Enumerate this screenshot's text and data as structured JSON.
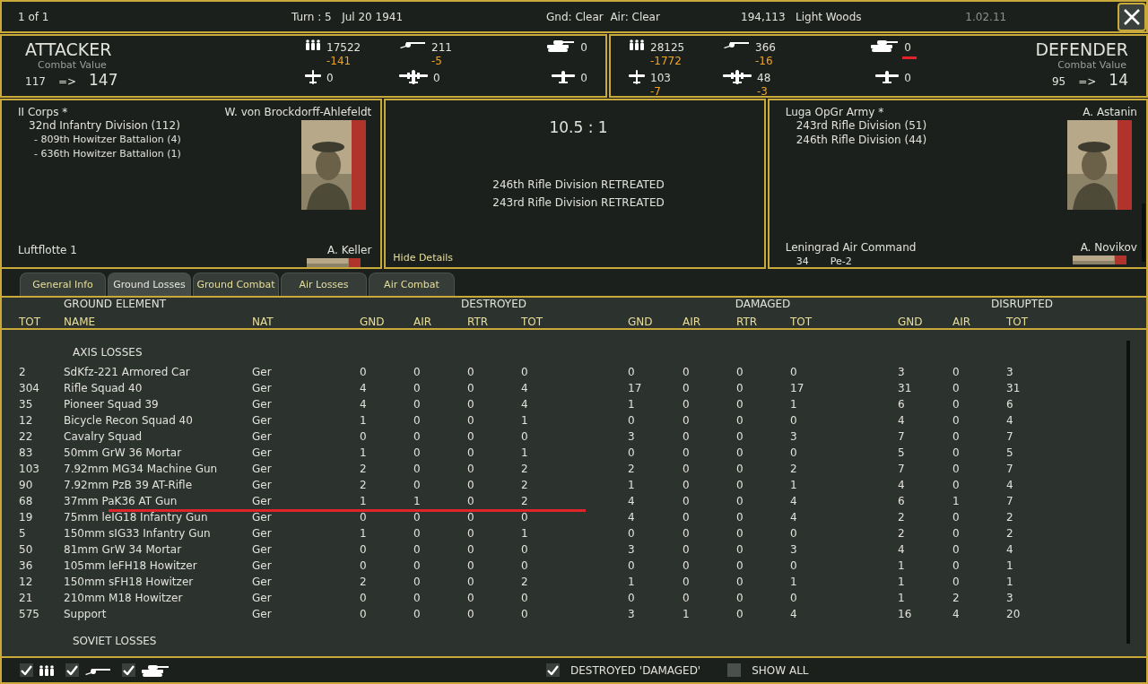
{
  "top_bar": {
    "page": "1 of 1",
    "turn": "Turn : 5   Jul 20 1941",
    "weather": "Gnd: Clear  Air: Clear",
    "location": "194,113   Light Woods",
    "version": "1.02.11"
  },
  "attacker": {
    "title": "ATTACKER",
    "cv_label": "Combat Value",
    "cv_from": "117",
    "cv_arrow": "=>",
    "cv_to": "147",
    "stats": [
      {
        "kind": "men",
        "value": "17522",
        "loss": "-141",
        "underlined": false
      },
      {
        "kind": "gun",
        "value": "211",
        "loss": "-5",
        "underlined": false
      },
      {
        "kind": "tank",
        "value": "0",
        "underlined": false
      },
      {
        "kind": "fighter",
        "value": "0",
        "underlined": false
      },
      {
        "kind": "bomber",
        "value": "0",
        "underlined": false
      },
      {
        "kind": "plane",
        "value": "0",
        "underlined": false
      }
    ]
  },
  "defender": {
    "title": "DEFENDER",
    "cv_label": "Combat Value",
    "cv_from": "95",
    "cv_arrow": "=>",
    "cv_to": "14",
    "stats": [
      {
        "kind": "men",
        "value": "28125",
        "loss": "-1772",
        "underlined": false
      },
      {
        "kind": "gun",
        "value": "366",
        "loss": "-16",
        "underlined": false
      },
      {
        "kind": "tank",
        "value": "0",
        "underlined": true
      },
      {
        "kind": "fighter",
        "value": "103",
        "loss": "-7",
        "underlined": false
      },
      {
        "kind": "bomber",
        "value": "48",
        "loss": "-3",
        "underlined": false
      },
      {
        "kind": "plane",
        "value": "0",
        "underlined": false
      }
    ]
  },
  "attacker_panel": {
    "hq": "II Corps *",
    "commander": "W. von Brockdorff-Ahlefeldt",
    "units": [
      {
        "name": "32nd Infantry Division (112)",
        "children": [
          {
            "name": "- 809th Howitzer Battalion (4)"
          },
          {
            "name": "- 636th Howitzer Battalion (1)"
          }
        ]
      }
    ],
    "air_hq": "Luftflotte 1",
    "air_commander": "A. Keller"
  },
  "result_panel": {
    "odds": "10.5 : 1",
    "results": [
      "246th Rifle Division RETREATED",
      "243rd Rifle Division RETREATED"
    ],
    "hide_link": "Hide Details"
  },
  "defender_panel": {
    "hq": "Luga OpGr Army *",
    "commander": "A. Astanin",
    "units": [
      {
        "name": "243rd Rifle Division (51)"
      },
      {
        "name": "246th Rifle Division (44)"
      }
    ],
    "air_hq": "Leningrad Air Command",
    "air_commander": "A. Novikov",
    "air_units": [
      {
        "count": "34",
        "type": "Pe-2"
      }
    ]
  },
  "tabs": [
    {
      "label": "General Info",
      "selected": false
    },
    {
      "label": "Ground Losses",
      "selected": true
    },
    {
      "label": "Ground Combat",
      "selected": false
    },
    {
      "label": "Air Losses",
      "selected": false
    },
    {
      "label": "Air Combat",
      "selected": false
    }
  ],
  "table": {
    "groups": [
      "GROUND ELEMENT",
      "DESTROYED",
      "DAMAGED",
      "DISRUPTED"
    ],
    "columns": [
      "TOT",
      "NAME",
      "NAT",
      "GND",
      "AIR",
      "RTR",
      "TOT",
      "GND",
      "AIR",
      "RTR",
      "TOT",
      "GND",
      "AIR",
      "TOT"
    ],
    "sections": [
      {
        "title": "AXIS LOSSES",
        "rows": [
          {
            "cells": [
              "2",
              "SdKfz-221 Armored Car",
              "Ger",
              "0",
              "0",
              "0",
              "0",
              "0",
              "0",
              "0",
              "0",
              "3",
              "0",
              "3"
            ],
            "underlined": false
          },
          {
            "cells": [
              "304",
              "Rifle Squad 40",
              "Ger",
              "4",
              "0",
              "0",
              "4",
              "17",
              "0",
              "0",
              "17",
              "31",
              "0",
              "31"
            ],
            "underlined": false
          },
          {
            "cells": [
              "35",
              "Pioneer Squad 39",
              "Ger",
              "4",
              "0",
              "0",
              "4",
              "1",
              "0",
              "0",
              "1",
              "6",
              "0",
              "6"
            ],
            "underlined": false
          },
          {
            "cells": [
              "12",
              "Bicycle Recon Squad 40",
              "Ger",
              "1",
              "0",
              "0",
              "1",
              "0",
              "0",
              "0",
              "0",
              "4",
              "0",
              "4"
            ],
            "underlined": false
          },
          {
            "cells": [
              "22",
              "Cavalry Squad",
              "Ger",
              "0",
              "0",
              "0",
              "0",
              "3",
              "0",
              "0",
              "3",
              "7",
              "0",
              "7"
            ],
            "underlined": false
          },
          {
            "cells": [
              "83",
              "50mm GrW 36 Mortar",
              "Ger",
              "1",
              "0",
              "0",
              "1",
              "0",
              "0",
              "0",
              "0",
              "5",
              "0",
              "5"
            ],
            "underlined": false
          },
          {
            "cells": [
              "103",
              "7.92mm MG34 Machine Gun",
              "Ger",
              "2",
              "0",
              "0",
              "2",
              "2",
              "0",
              "0",
              "2",
              "7",
              "0",
              "7"
            ],
            "underlined": false
          },
          {
            "cells": [
              "90",
              "7.92mm PzB 39 AT-Rifle",
              "Ger",
              "2",
              "0",
              "0",
              "2",
              "1",
              "0",
              "0",
              "1",
              "4",
              "0",
              "4"
            ],
            "underlined": false
          },
          {
            "cells": [
              "68",
              "37mm PaK36 AT Gun",
              "Ger",
              "1",
              "1",
              "0",
              "2",
              "4",
              "0",
              "0",
              "4",
              "6",
              "1",
              "7"
            ],
            "underlined": true
          },
          {
            "cells": [
              "19",
              "75mm leIG18 Infantry Gun",
              "Ger",
              "0",
              "0",
              "0",
              "0",
              "4",
              "0",
              "0",
              "4",
              "2",
              "0",
              "2"
            ],
            "underlined": false
          },
          {
            "cells": [
              "5",
              "150mm sIG33 Infantry Gun",
              "Ger",
              "1",
              "0",
              "0",
              "1",
              "0",
              "0",
              "0",
              "0",
              "2",
              "0",
              "2"
            ],
            "underlined": false
          },
          {
            "cells": [
              "50",
              "81mm GrW 34 Mortar",
              "Ger",
              "0",
              "0",
              "0",
              "0",
              "3",
              "0",
              "0",
              "3",
              "4",
              "0",
              "4"
            ],
            "underlined": false
          },
          {
            "cells": [
              "36",
              "105mm leFH18 Howitzer",
              "Ger",
              "0",
              "0",
              "0",
              "0",
              "0",
              "0",
              "0",
              "0",
              "1",
              "0",
              "1"
            ],
            "underlined": false
          },
          {
            "cells": [
              "12",
              "150mm sFH18 Howitzer",
              "Ger",
              "2",
              "0",
              "0",
              "2",
              "1",
              "0",
              "0",
              "1",
              "1",
              "0",
              "1"
            ],
            "underlined": false
          },
          {
            "cells": [
              "21",
              "210mm M18 Howitzer",
              "Ger",
              "0",
              "0",
              "0",
              "0",
              "0",
              "0",
              "0",
              "0",
              "1",
              "2",
              "3"
            ],
            "underlined": false
          },
          {
            "cells": [
              "575",
              "Support",
              "Ger",
              "0",
              "0",
              "0",
              "0",
              "3",
              "1",
              "0",
              "4",
              "16",
              "4",
              "20"
            ],
            "underlined": false
          }
        ]
      },
      {
        "title": "SOVIET LOSSES"
      }
    ]
  },
  "footer": {
    "filters": [
      {
        "kind": "men",
        "checked": true
      },
      {
        "kind": "gun",
        "checked": true
      },
      {
        "kind": "tank",
        "checked": true
      }
    ],
    "options": [
      {
        "label": "DESTROYED 'DAMAGED'",
        "checked": true
      },
      {
        "label": "SHOW ALL",
        "checked": false
      }
    ]
  }
}
